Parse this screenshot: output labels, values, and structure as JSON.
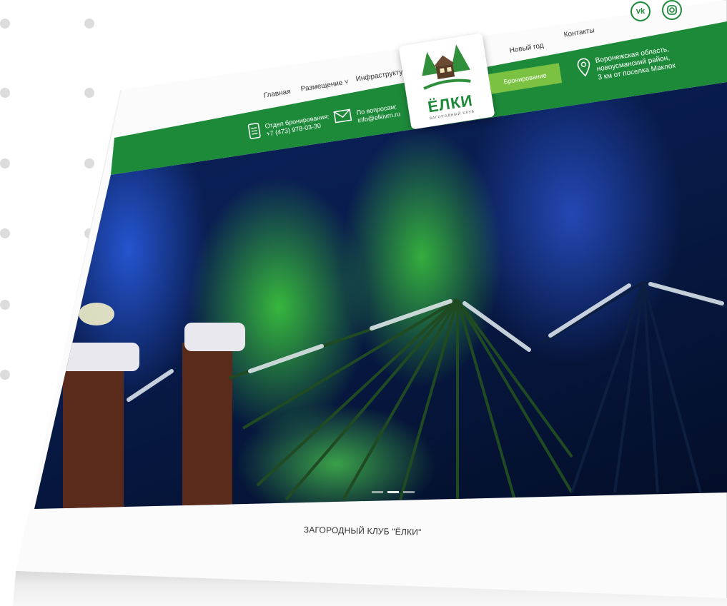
{
  "nav": {
    "items": [
      {
        "label": "Главная"
      },
      {
        "label": "Размещение ˅"
      },
      {
        "label": "Инфраструктура ˅"
      },
      {
        "label": "Новый год"
      },
      {
        "label": "Контакты"
      }
    ]
  },
  "logo": {
    "title": "ЁЛКИ",
    "subtitle": "ЗАГОРОДНЫЙ КЛУБ"
  },
  "booking_dept": {
    "label": "Отдел бронирования:",
    "phone": "+7 (473) 978-03-30"
  },
  "questions": {
    "label": "По вопросам:",
    "email": "info@elkivrn.ru"
  },
  "booking_button": "Бронирование",
  "address": {
    "line1": "Воронежская область,",
    "line2": "новоусманский район,",
    "line3": "3 км от поселка Маклок"
  },
  "social": {
    "vk": "vk",
    "instagram": "instagram-icon"
  },
  "caption": "ЗАГОРОДНЫЙ КЛУБ \"ЁЛКИ\"",
  "colors": {
    "brand_green": "#1d8a3a",
    "button_green": "#7cc242"
  }
}
